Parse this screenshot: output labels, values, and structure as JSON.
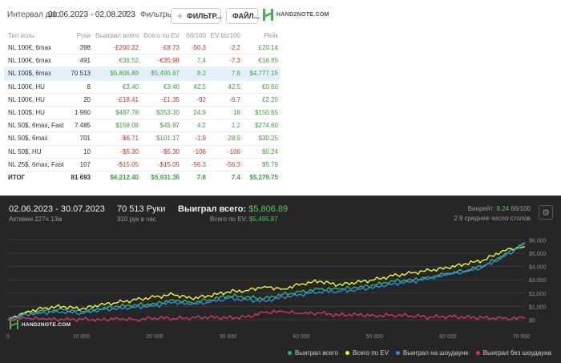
{
  "filters": {
    "interval_label": "Интервал дат:",
    "date_range": "01.06.2023 - 02.08.2023",
    "filters_label": "Фильтры:",
    "filter_button": "ФИЛЬТР...",
    "file_button": "ФАЙЛ...",
    "logo_text": "HAND2NOTE.COM"
  },
  "table": {
    "headers": [
      "Тип игры",
      "Руки",
      "Выиграл всего",
      "Всего по EV",
      "бб/100",
      "EV bb/100",
      "Рейк"
    ],
    "rows": [
      {
        "cells": [
          "NL 100€, 6max",
          "398",
          "-£200.22",
          "-£8.73",
          "-50.3",
          "-2.2",
          "£20.14"
        ],
        "signs": [
          "",
          "",
          "neg",
          "neg",
          "neg",
          "neg",
          "pos"
        ]
      },
      {
        "cells": [
          "NL 100€, 6max",
          "491",
          "€36.52",
          "-€35.98",
          "7.4",
          "-7.3",
          "€18.85"
        ],
        "signs": [
          "",
          "",
          "pos",
          "neg",
          "pos",
          "neg",
          "pos"
        ]
      },
      {
        "cells": [
          "NL 100$, 6max",
          "70 513",
          "$5,806.89",
          "$5,495.87",
          "8.2",
          "7.8",
          "$4,777.15"
        ],
        "signs": [
          "",
          "",
          "pos",
          "pos",
          "pos",
          "pos",
          "pos"
        ]
      },
      {
        "cells": [
          "NL 100€, HU",
          "8",
          "€3.40",
          "€3.40",
          "42.5",
          "42.5",
          "€0.60"
        ],
        "signs": [
          "",
          "",
          "pos",
          "pos",
          "pos",
          "pos",
          "pos"
        ]
      },
      {
        "cells": [
          "NL 100€, HU",
          "20",
          "-£18.41",
          "-£1.35",
          "-92",
          "-6.7",
          "£2.20"
        ],
        "signs": [
          "",
          "",
          "neg",
          "neg",
          "neg",
          "neg",
          "pos"
        ]
      },
      {
        "cells": [
          "NL 100$, HU",
          "1 960",
          "$487.78",
          "$353.30",
          "24.9",
          "18",
          "$150.65"
        ],
        "signs": [
          "",
          "",
          "pos",
          "pos",
          "pos",
          "pos",
          "pos"
        ]
      },
      {
        "cells": [
          "NL 50$, 6max, Fast",
          "7 485",
          "$158.08",
          "$45.97",
          "4.2",
          "1.2",
          "$274.60"
        ],
        "signs": [
          "",
          "",
          "pos",
          "pos",
          "pos",
          "pos",
          "pos"
        ]
      },
      {
        "cells": [
          "NL 50$, 6max",
          "701",
          "-$6.71",
          "$101.17",
          "-1.9",
          "28.9",
          "$30.25"
        ],
        "signs": [
          "",
          "",
          "neg",
          "pos",
          "neg",
          "pos",
          "pos"
        ]
      },
      {
        "cells": [
          "NL 50$, HU",
          "10",
          "-$5.30",
          "-$5.30",
          "-106",
          "-106",
          "$0.24"
        ],
        "signs": [
          "",
          "",
          "neg",
          "neg",
          "neg",
          "neg",
          "pos"
        ]
      },
      {
        "cells": [
          "NL 25$, 6max, Fast",
          "107",
          "-$15.05",
          "-$15.05",
          "-56.3",
          "-56.3",
          "$5.79"
        ],
        "signs": [
          "",
          "",
          "neg",
          "neg",
          "neg",
          "neg",
          "pos"
        ]
      },
      {
        "cells": [
          "ИТОГ",
          "81 693",
          "$6,212.40",
          "$5,931.36",
          "7.8",
          "7.4",
          "$5,279.75"
        ],
        "signs": [
          "",
          "",
          "pos",
          "pos",
          "pos",
          "pos",
          "pos"
        ]
      }
    ]
  },
  "summary": {
    "date_range": "02.06.2023 - 30.07.2023",
    "active": "Активен 227ч 13м",
    "hands": "70 513 Руки",
    "hands_rate": "310 рук в час",
    "won_label": "Выиграл всего:",
    "won_value": "$5,806.89",
    "ev_label": "Всего по EV:",
    "ev_value": "$5,495.87",
    "winrate_label": "Винрейт:",
    "winrate_value": "8.24",
    "winrate_unit": "бб/100",
    "tables_text": "2.9 среднее число столов"
  },
  "colors": {
    "won": "#2bb673",
    "ev": "#f2f23a",
    "showdown": "#3a86d9",
    "no_showdown": "#d6336c",
    "positive": "#3aa63a",
    "negative": "#d9341f"
  },
  "chart_data": {
    "type": "line",
    "x_ticks": [
      "0",
      "10 000",
      "20 000",
      "30 000",
      "40 000",
      "50 000",
      "60 000",
      "70 000"
    ],
    "y_ticks": [
      "$0",
      "$1,000",
      "$2,000",
      "$3,000",
      "$4,000",
      "$5,000",
      "$6,000"
    ],
    "xlim": [
      0,
      70513
    ],
    "ylim": [
      -300,
      6200
    ],
    "x": [
      0,
      2500,
      5000,
      7500,
      10000,
      12500,
      15000,
      17500,
      20000,
      22500,
      25000,
      27500,
      30000,
      32500,
      35000,
      37500,
      40000,
      42500,
      45000,
      47500,
      50000,
      52500,
      55000,
      57500,
      60000,
      62500,
      65000,
      67500,
      70513
    ],
    "series": [
      {
        "name": "Выиграл всего",
        "color": "#2bb673",
        "values": [
          0,
          500,
          650,
          750,
          600,
          800,
          1000,
          1100,
          1200,
          1500,
          1300,
          1500,
          1800,
          1700,
          1600,
          1900,
          2100,
          2300,
          2300,
          2400,
          2600,
          2900,
          3000,
          3200,
          3500,
          3700,
          4100,
          4800,
          5806.89
        ]
      },
      {
        "name": "Всего по EV",
        "color": "#f2f23a",
        "values": [
          0,
          600,
          900,
          1000,
          800,
          1100,
          1300,
          1500,
          1700,
          1900,
          1600,
          1800,
          2100,
          2200,
          2500,
          2300,
          2700,
          2900,
          2600,
          2800,
          3000,
          3300,
          3500,
          3700,
          3900,
          4200,
          4500,
          5200,
          5495.87
        ]
      },
      {
        "name": "Выиграл на шоудауне",
        "color": "#3a86d9",
        "values": [
          0,
          400,
          550,
          600,
          500,
          750,
          850,
          950,
          1050,
          1300,
          1150,
          1300,
          1600,
          1500,
          1400,
          1700,
          1900,
          2100,
          2150,
          2250,
          2450,
          2700,
          2850,
          3100,
          3400,
          3600,
          4000,
          4700,
          5700
        ]
      },
      {
        "name": "Выиграл без шоудауна",
        "color": "#d6336c",
        "values": [
          0,
          100,
          50,
          0,
          50,
          0,
          100,
          0,
          150,
          100,
          150,
          200,
          150,
          200,
          550,
          600,
          450,
          500,
          350,
          400,
          300,
          350,
          300,
          200,
          250,
          200,
          150,
          100,
          120
        ]
      }
    ]
  }
}
